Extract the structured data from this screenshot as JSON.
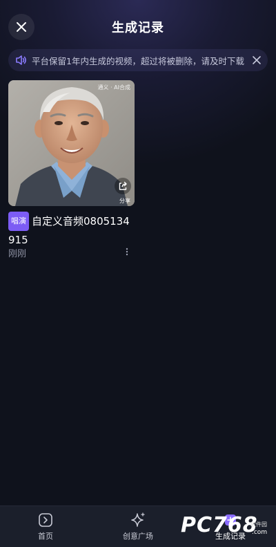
{
  "header": {
    "title": "生成记录",
    "close_icon": "close-icon"
  },
  "notice": {
    "text": "平台保留1年内生成的视频，超过将被删除，请及时下载",
    "icon": "speaker-icon",
    "accent": "#8b7cff"
  },
  "items": [
    {
      "watermark": "通义 · AI合成",
      "share_label": "分享",
      "badge": "唱演",
      "title": "自定义音频0805134915",
      "time": "刚刚",
      "badge_color": "#7c5cf4"
    }
  ],
  "tabbar": {
    "tabs": [
      {
        "label": "首页",
        "icon": "home-icon"
      },
      {
        "label": "创意广场",
        "icon": "sparkle-icon"
      },
      {
        "label": "生成记录",
        "icon": "history-icon"
      }
    ],
    "active": "生成记录"
  },
  "brand": {
    "logo": "PC768",
    "domain": ".com",
    "sub": "软件园"
  }
}
